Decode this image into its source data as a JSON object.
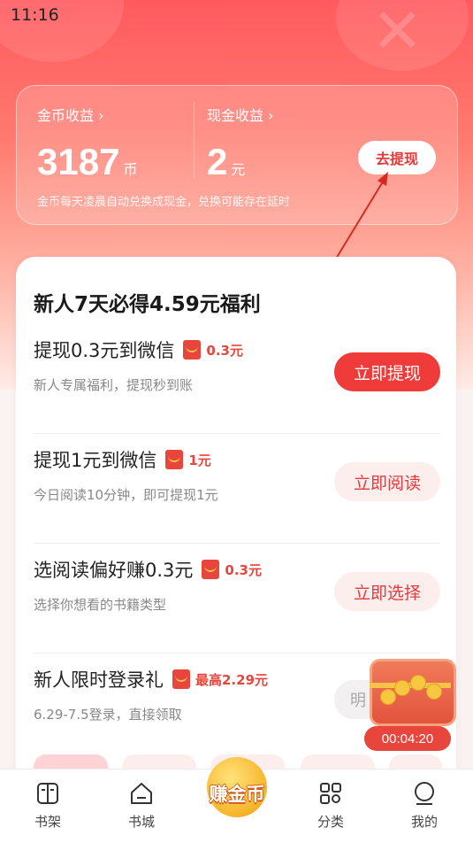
{
  "status_bar": {
    "time": "11:16"
  },
  "earnings": {
    "coin_label": "金币收益 ›",
    "coin_value": "3187",
    "coin_unit": "币",
    "cash_label": "现金收益 ›",
    "cash_value": "2",
    "cash_unit": "元",
    "withdraw_button": "去提现",
    "note": "金币每天凌晨自动兑换成现金，兑换可能存在延时"
  },
  "tasks": {
    "title": "新人7天必得4.59元福利",
    "items": [
      {
        "name": "提现0.3元到微信",
        "reward": "0.3元",
        "desc": "新人专属福利，提现秒到账",
        "button": "立即提现"
      },
      {
        "name": "提现1元到微信",
        "reward": "1元",
        "desc": "今日阅读10分钟，即可提现1元",
        "button": "立即阅读"
      },
      {
        "name": "选阅读偏好赚0.3元",
        "reward": "0.3元",
        "desc": "选择你想看的书籍类型",
        "button": "立即选择"
      },
      {
        "name": "新人限时登录礼",
        "reward": "最高2.29元",
        "desc": "6.29-7.5登录，直接领取",
        "button": "明"
      }
    ]
  },
  "treasure": {
    "timer": "00:04:20",
    "icon": "treasure-chest-icon"
  },
  "bottom_nav": {
    "items": [
      {
        "label": "书架",
        "icon": "bookshelf-icon"
      },
      {
        "label": "书城",
        "icon": "bookstore-icon"
      },
      {
        "label": "赚金币",
        "icon": "earn-coins-icon"
      },
      {
        "label": "分类",
        "icon": "category-icon"
      },
      {
        "label": "我的",
        "icon": "profile-icon"
      }
    ]
  },
  "colors": {
    "accent": "#ef3b39",
    "header_top": "#ff5a5f",
    "light_button": "#fdeeee"
  }
}
